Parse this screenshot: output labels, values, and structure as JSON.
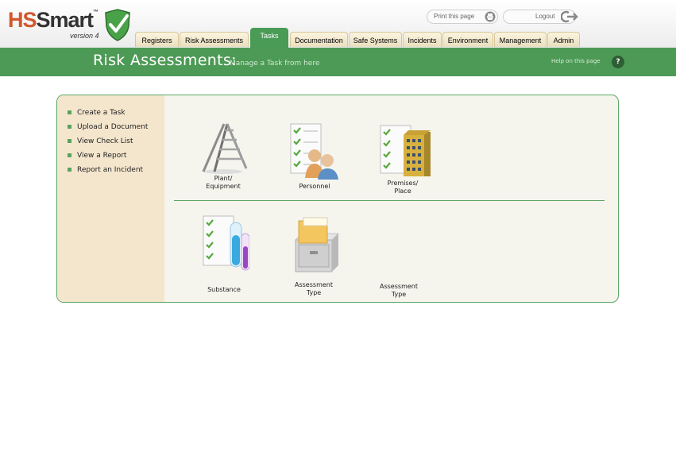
{
  "brand": {
    "name_part1": "HS",
    "name_part2": "Smart",
    "trademark": "™",
    "version": "version 4"
  },
  "header": {
    "print_label": "Print this page",
    "logout_label": "Logout"
  },
  "tabs": [
    {
      "label": "Registers"
    },
    {
      "label": "Risk Assessments"
    },
    {
      "label": "Tasks"
    },
    {
      "label": "Documentation"
    },
    {
      "label": "Safe Systems"
    },
    {
      "label": "Incidents"
    },
    {
      "label": "Environment"
    },
    {
      "label": "Management"
    },
    {
      "label": "Admin"
    }
  ],
  "active_tab": "Tasks",
  "page": {
    "title": "Risk Assessments:",
    "subtitle": "Manage a Task from here",
    "help": "Help on this page",
    "help_icon": "?"
  },
  "sidebar": [
    {
      "label": "Create a Task"
    },
    {
      "label": "Upload a Document"
    },
    {
      "label": "View Check List"
    },
    {
      "label": "View a Report"
    },
    {
      "label": "Report an Incident"
    }
  ],
  "items": [
    {
      "line1": "Plant/",
      "line2": "Equipment",
      "icon": "ladder-icon"
    },
    {
      "line1": "Personnel",
      "line2": "",
      "icon": "people-checklist-icon"
    },
    {
      "line1": "Premises/",
      "line2": "Place",
      "icon": "building-checklist-icon"
    },
    {
      "line1": "Substance",
      "line2": "",
      "icon": "test-tubes-icon"
    },
    {
      "line1": "Assessment",
      "line2": "Type",
      "icon": "file-cabinet-icon"
    },
    {
      "line1": "Assessment",
      "line2": "Type",
      "icon": ""
    }
  ],
  "colors": {
    "brand_green": "#4d9a56",
    "logo_orange": "#d2572b",
    "sidebar_bg": "#f4e6cd",
    "panel_bg": "#f5f5ee"
  }
}
